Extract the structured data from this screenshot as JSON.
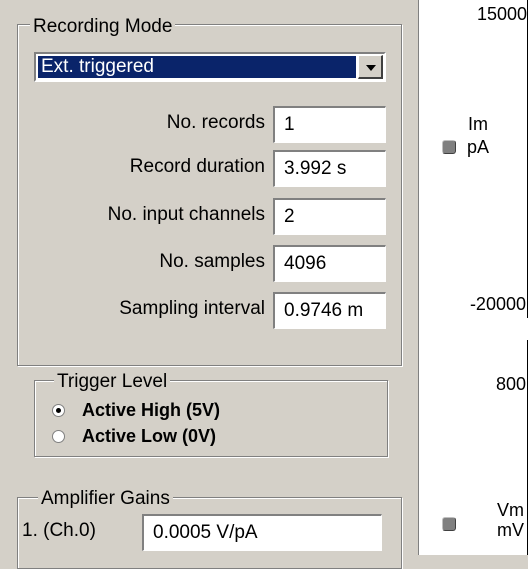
{
  "recording_mode": {
    "title": "Recording Mode",
    "selected": "Ext. triggered"
  },
  "params": [
    {
      "label": "No. records",
      "value": "1"
    },
    {
      "label": "Record duration",
      "value": "3.992 s"
    },
    {
      "label": "No. input channels",
      "value": "2"
    },
    {
      "label": "No. samples",
      "value": "4096"
    },
    {
      "label": "Sampling interval",
      "value": "0.9746 m"
    }
  ],
  "trigger": {
    "title": "Trigger Level",
    "options": [
      {
        "label": "Active High (5V)",
        "checked": true
      },
      {
        "label": "Active Low (0V)",
        "checked": false
      }
    ]
  },
  "gains": {
    "title": "Amplifier Gains",
    "channel_label": "1. (Ch.0)",
    "channel_value": "0.0005 V/pA"
  },
  "right": {
    "top_cut": "15000",
    "im_label": "Im",
    "im_unit": "pA",
    "im_min": "-20000",
    "vm_max": "800",
    "vm_label": "Vm",
    "vm_unit": "mV"
  }
}
